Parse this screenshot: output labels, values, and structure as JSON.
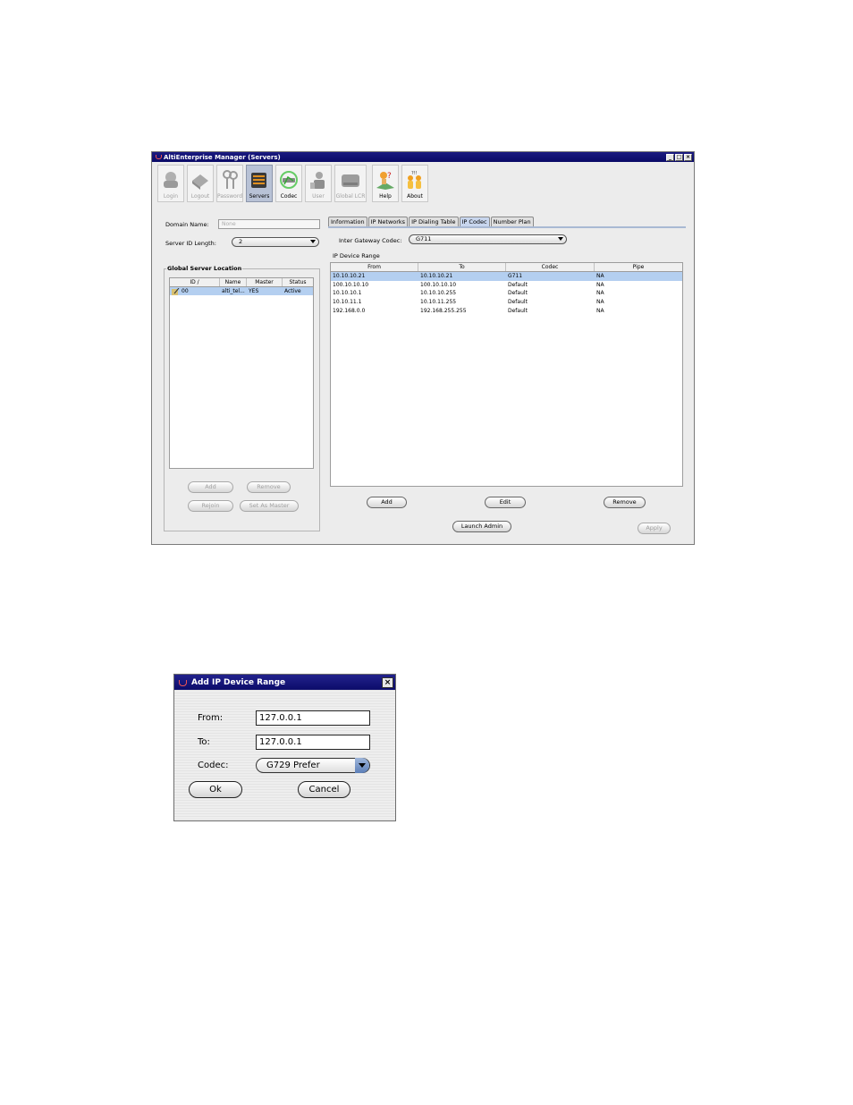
{
  "window": {
    "title": "AltiEnterprise Manager  (Servers)",
    "controls": [
      "_",
      "□",
      "×"
    ]
  },
  "toolbar": [
    {
      "label": "Login",
      "icon": "login-icon",
      "enabled": false
    },
    {
      "label": "Logout",
      "icon": "logout-icon",
      "enabled": false
    },
    {
      "label": "Password",
      "icon": "password-keys-icon",
      "enabled": false
    },
    {
      "label": "Servers",
      "icon": "servers-icon",
      "enabled": true,
      "selected": true
    },
    {
      "label": "Codec",
      "icon": "codec-icon",
      "enabled": true
    },
    {
      "label": "User",
      "icon": "user-icon",
      "enabled": false
    },
    {
      "label": "Global LCR",
      "icon": "global-lcr-icon",
      "enabled": false
    },
    {
      "label": "Help",
      "icon": "help-icon",
      "enabled": true
    },
    {
      "label": "About",
      "icon": "about-icon",
      "enabled": true
    }
  ],
  "left": {
    "domain_label": "Domain Name:",
    "domain_value": "None",
    "server_id_label": "Server ID Length:",
    "server_id_value": "2",
    "group_title": "Global Server Location",
    "columns": [
      "ID /",
      "Name",
      "Master",
      "Status"
    ],
    "rows": [
      {
        "id": "00",
        "name": "alti_tel...",
        "master": "YES",
        "status": "Active"
      }
    ],
    "buttons": {
      "add": "Add",
      "remove": "Remove",
      "rejoin": "Rejoin",
      "set_master": "Set As Master"
    }
  },
  "tabs": [
    "Information",
    "IP Networks",
    "IP Dialing Table",
    "IP Codec",
    "Number Plan"
  ],
  "active_tab": "IP Codec",
  "codec": {
    "gateway_label": "Inter Gateway Codec:",
    "gateway_value": "G711",
    "range_title": "IP Device Range",
    "columns": [
      "From",
      "To",
      "Codec",
      "Pipe"
    ],
    "rows": [
      {
        "from": "10.10.10.21",
        "to": "10.10.10.21",
        "codec": "G711",
        "pipe": "NA"
      },
      {
        "from": "100.10.10.10",
        "to": "100.10.10.10",
        "codec": "Default",
        "pipe": "NA"
      },
      {
        "from": "10.10.10.1",
        "to": "10.10.10.255",
        "codec": "Default",
        "pipe": "NA"
      },
      {
        "from": "10.10.11.1",
        "to": "10.10.11.255",
        "codec": "Default",
        "pipe": "NA"
      },
      {
        "from": "192.168.0.0",
        "to": "192.168.255.255",
        "codec": "Default",
        "pipe": "NA"
      }
    ],
    "buttons": {
      "add": "Add",
      "edit": "Edit",
      "remove": "Remove",
      "launch": "Launch Admin",
      "apply": "Apply"
    }
  },
  "dialog": {
    "title": "Add IP Device Range",
    "close": "×",
    "from_label": "From:",
    "from_value": "127.0.0.1",
    "to_label": "To:",
    "to_value": "127.0.0.1",
    "codec_label": "Codec:",
    "codec_value": "G729 Prefer",
    "ok": "Ok",
    "cancel": "Cancel"
  },
  "colors": {
    "titlebar": "#0a0a66",
    "selection": "#b4cff0",
    "active_tab": "#c8d6ee"
  }
}
